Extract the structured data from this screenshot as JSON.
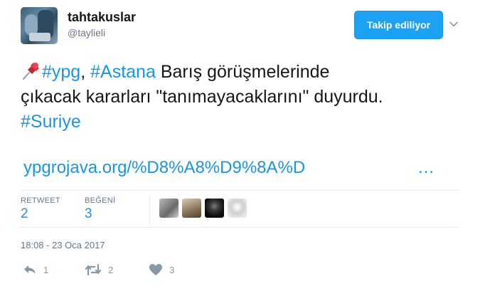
{
  "user": {
    "display_name": "tahtakuslar",
    "handle": "@taylieli",
    "avatar_icon": "profile-photo"
  },
  "follow_button": {
    "label": "Takip ediliyor",
    "color": "#1da1f2"
  },
  "tweet": {
    "pin_icon": "pushpin-icon",
    "hashtag_ypg": "#ypg",
    "comma": ",",
    "hashtag_astana": "#Astana",
    "text_line1": " Barış görüşmelerinde",
    "text_line2": "çıkacak kararları \"tanımayacaklarını\" duyurdu.",
    "hashtag_suriye": "#Suriye",
    "link": "ypgrojava.org/%D8%A8%D9%8A%D",
    "link_ellipsis": "…"
  },
  "stats": {
    "retweet_label": "RETWEET",
    "retweet_count": "2",
    "like_label": "BEĞENİ",
    "like_count": "3",
    "likers": [
      "liker-avatar-1",
      "liker-avatar-2",
      "liker-avatar-3",
      "liker-avatar-4"
    ]
  },
  "timestamp": "18:08 - 23 Oca 2017",
  "actions": {
    "reply_count": "1",
    "retweet_count": "2",
    "like_count": "3"
  },
  "colors": {
    "link": "#1b95e0",
    "muted": "#657786",
    "icon": "#8899a6",
    "border": "#e6ecf0"
  }
}
